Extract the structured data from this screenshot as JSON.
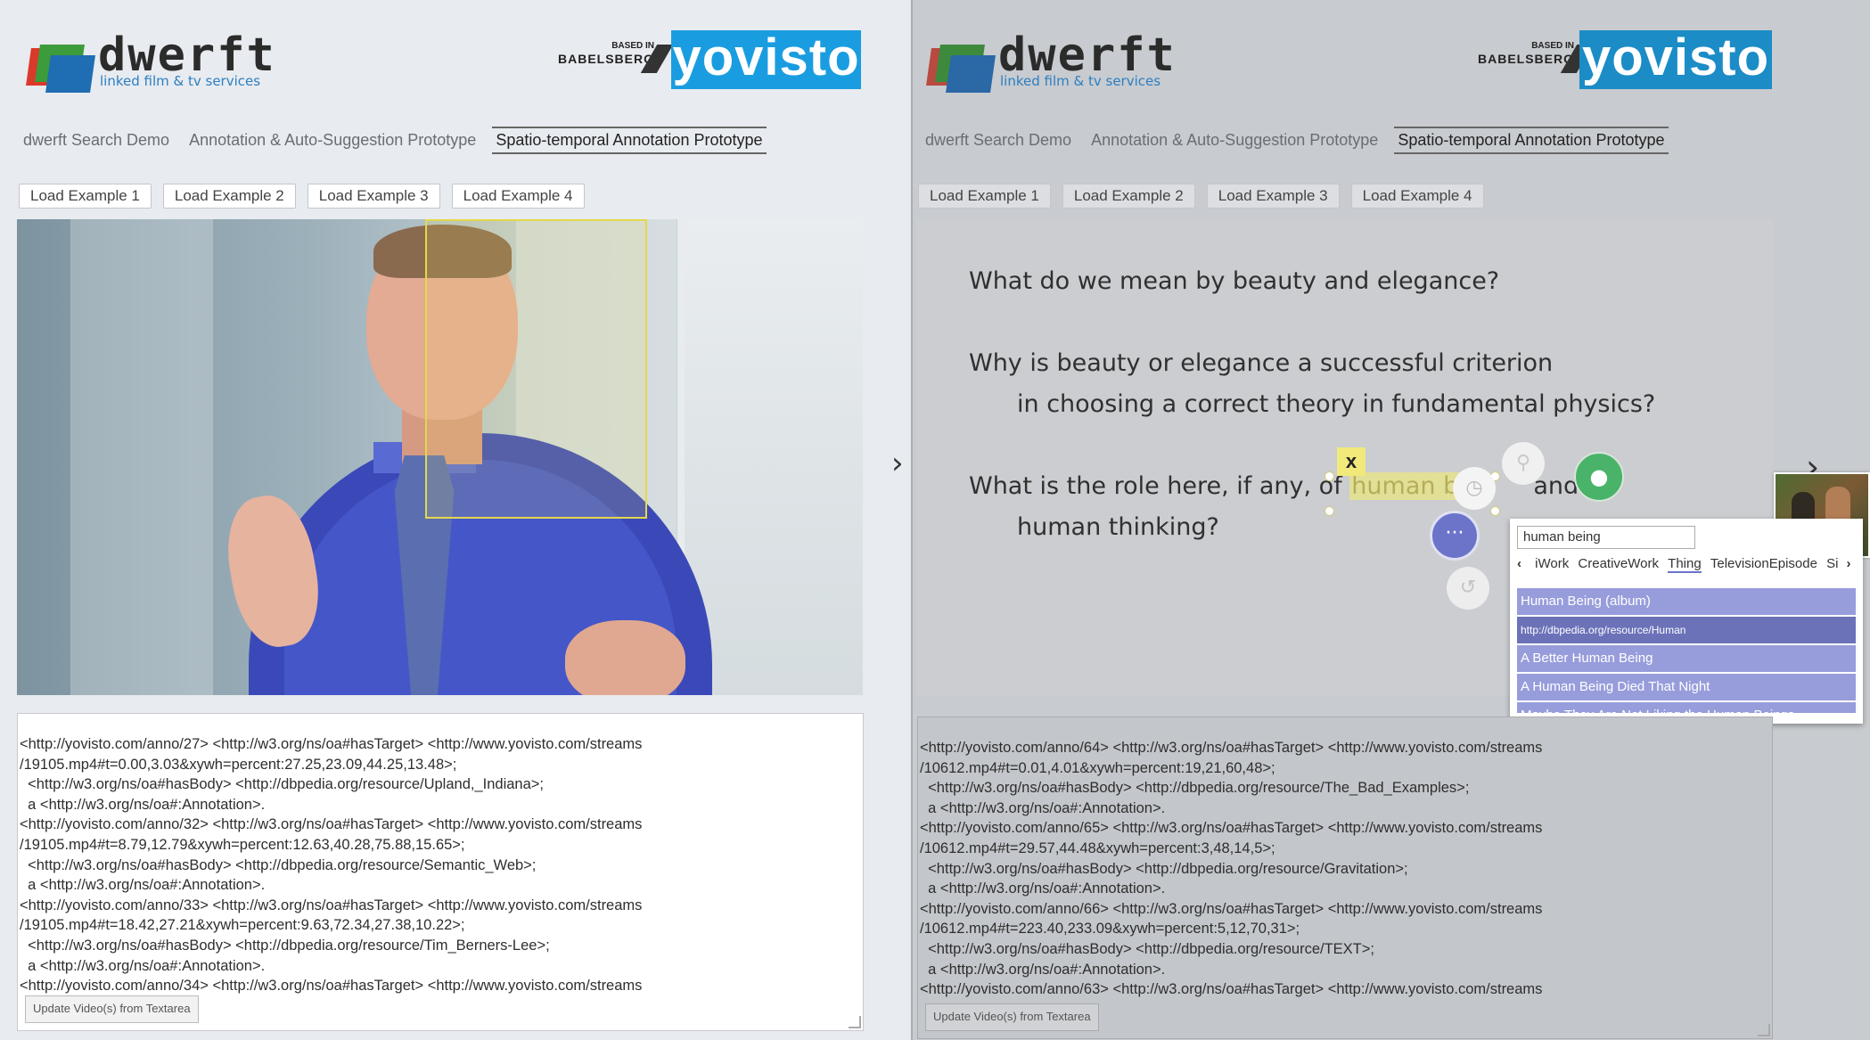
{
  "colors": {
    "accent_blue": "#1a9de0",
    "highlight": "#f1e97a",
    "suggest_purple": "#979ddb",
    "green_person": "#4ab36a"
  },
  "left": {
    "logo": {
      "name": "dwerft",
      "tagline": "linked film & tv services"
    },
    "partner": {
      "small": "BASED IN",
      "big": "BABELSBERG"
    },
    "yovisto": "yovisto",
    "nav": [
      "dwerft Search Demo",
      "Annotation & Auto-Suggestion Prototype",
      "Spatio-temporal Annotation Prototype"
    ],
    "examples": [
      "Load Example 1",
      "Load Example 2",
      "Load Example 3",
      "Load Example 4"
    ],
    "textarea_lines": [
      "<http://yovisto.com/anno/27> <http://w3.org/ns/oa#hasTarget> <http://www.yovisto.com/streams",
      "/19105.mp4#t=0.00,3.03&xywh=percent:27.25,23.09,44.25,13.48>;",
      "  <http://w3.org/ns/oa#hasBody> <http://dbpedia.org/resource/Upland,_Indiana>;",
      "  a <http://w3.org/ns/oa#:Annotation>.",
      "<http://yovisto.com/anno/32> <http://w3.org/ns/oa#hasTarget> <http://www.yovisto.com/streams",
      "/19105.mp4#t=8.79,12.79&xywh=percent:12.63,40.28,75.88,15.65>;",
      "  <http://w3.org/ns/oa#hasBody> <http://dbpedia.org/resource/Semantic_Web>;",
      "  a <http://w3.org/ns/oa#:Annotation>.",
      "<http://yovisto.com/anno/33> <http://w3.org/ns/oa#hasTarget> <http://www.yovisto.com/streams",
      "/19105.mp4#t=18.42,27.21&xywh=percent:9.63,72.34,27.38,10.22>;",
      "  <http://w3.org/ns/oa#hasBody> <http://dbpedia.org/resource/Tim_Berners-Lee>;",
      "  a <http://w3.org/ns/oa#:Annotation>.",
      "<http://yovisto.com/anno/34> <http://w3.org/ns/oa#hasTarget> <http://www.yovisto.com/streams"
    ],
    "update_button": "Update Video(s) from Textarea"
  },
  "right": {
    "logo": {
      "name": "dwerft",
      "tagline": "linked film & tv services"
    },
    "partner": {
      "small": "BASED IN",
      "big": "BABELSBERG"
    },
    "yovisto": "yovisto",
    "nav": [
      "dwerft Search Demo",
      "Annotation & Auto-Suggestion Prototype",
      "Spatio-temporal Annotation Prototype"
    ],
    "examples": [
      "Load Example 1",
      "Load Example 2",
      "Load Example 3",
      "Load Example 4"
    ],
    "slide": {
      "line1": "What do we mean by beauty and elegance?",
      "line2": "Why is beauty or elegance a successful criterion",
      "line3": "in choosing a correct theory in fundamental physics?",
      "line4_pre": "What is the role here, if any, of ",
      "line4_highlight": "human bei",
      "line4_post": "and",
      "line5": "human thinking?"
    },
    "close_label": "x",
    "suggest": {
      "query": "human being",
      "types": [
        "iWork",
        "CreativeWork",
        "Thing",
        "TelevisionEpisode",
        "Si"
      ],
      "selected_type": "Thing",
      "results": [
        "Human Being (album)",
        "http://dbpedia.org/resource/Human",
        "A Better Human Being",
        "A Human Being Died That Night",
        "Maybe They Are Not Liking the Human Beings"
      ]
    },
    "textarea_lines": [
      "<http://yovisto.com/anno/64> <http://w3.org/ns/oa#hasTarget> <http://www.yovisto.com/streams",
      "/10612.mp4#t=0.01,4.01&xywh=percent:19,21,60,48>;",
      "  <http://w3.org/ns/oa#hasBody> <http://dbpedia.org/resource/The_Bad_Examples>;",
      "  a <http://w3.org/ns/oa#:Annotation>.",
      "<http://yovisto.com/anno/65> <http://w3.org/ns/oa#hasTarget> <http://www.yovisto.com/streams",
      "/10612.mp4#t=29.57,44.48&xywh=percent:3,48,14,5>;",
      "  <http://w3.org/ns/oa#hasBody> <http://dbpedia.org/resource/Gravitation>;",
      "  a <http://w3.org/ns/oa#:Annotation>.",
      "<http://yovisto.com/anno/66> <http://w3.org/ns/oa#hasTarget> <http://www.yovisto.com/streams",
      "/10612.mp4#t=223.40,233.09&xywh=percent:5,12,70,31>;",
      "  <http://w3.org/ns/oa#hasBody> <http://dbpedia.org/resource/TEXT>;",
      "  a <http://w3.org/ns/oa#:Annotation>.",
      "<http://yovisto.com/anno/63> <http://w3.org/ns/oa#hasTarget> <http://www.yovisto.com/streams"
    ],
    "update_button": "Update Video(s) from Textarea"
  },
  "icons": {
    "next_arrow": "chevron-right-icon",
    "clock": "clock-icon",
    "pin": "location-pin-icon",
    "person": "person-icon",
    "more": "more-icon",
    "undo": "undo-icon"
  }
}
